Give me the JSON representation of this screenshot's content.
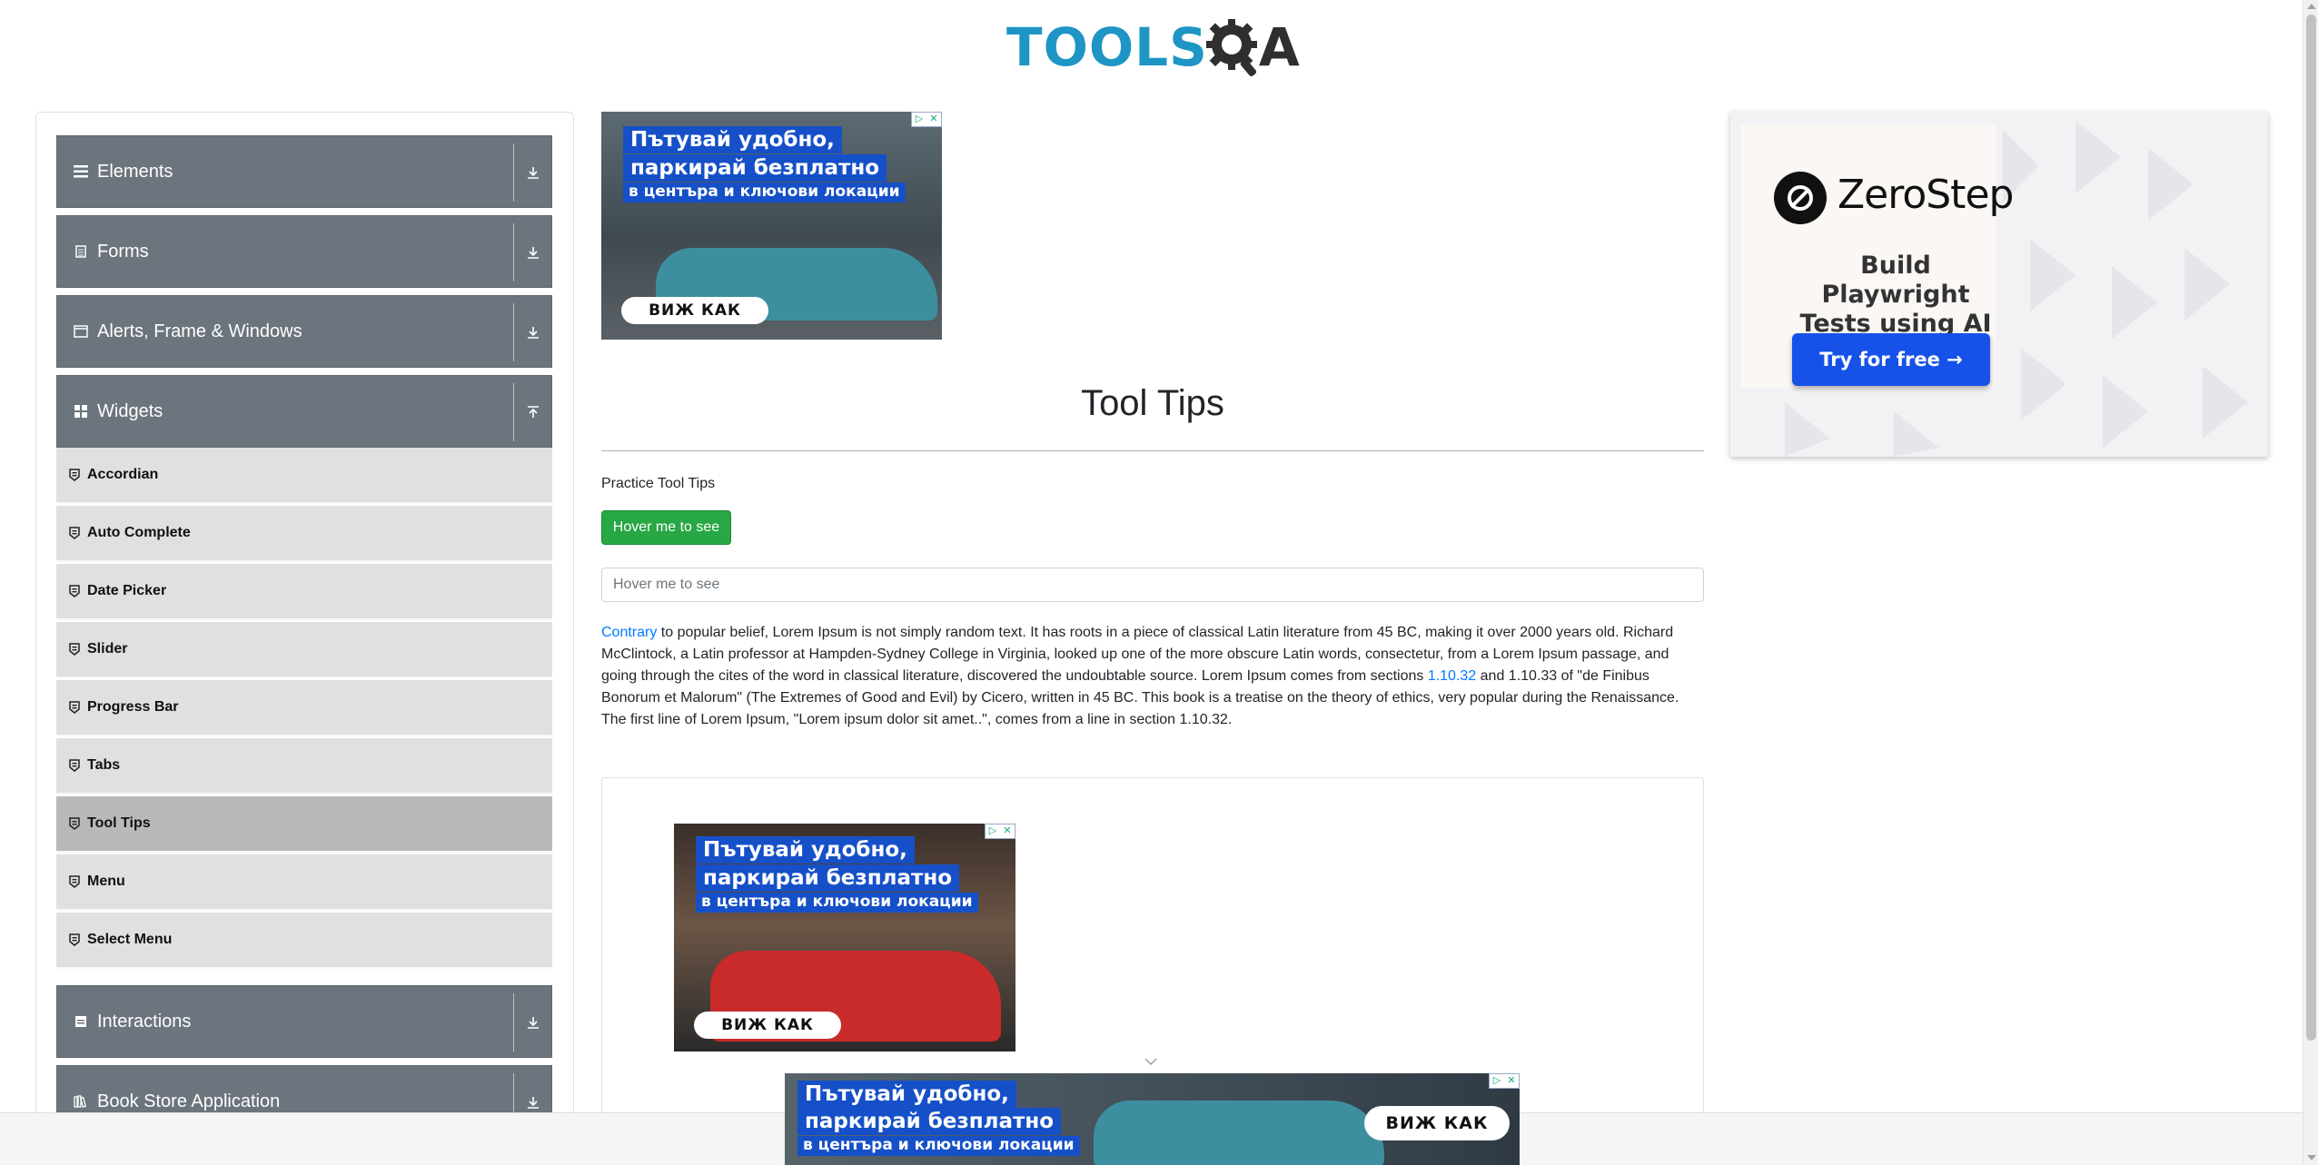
{
  "logo": {
    "text": "TOOLS",
    "suffix": "A"
  },
  "sidebar": {
    "groups": [
      {
        "label": "Elements",
        "icon": "hamburger-icon",
        "toggle": "download-arrow-icon"
      },
      {
        "label": "Forms",
        "icon": "document-icon",
        "toggle": "download-arrow-icon"
      },
      {
        "label": "Alerts, Frame & Windows",
        "icon": "window-icon",
        "toggle": "download-arrow-icon"
      },
      {
        "label": "Widgets",
        "icon": "grid-icon",
        "toggle": "upload-arrow-icon"
      },
      {
        "label": "Interactions",
        "icon": "interaction-icon",
        "toggle": "download-arrow-icon"
      },
      {
        "label": "Book Store Application",
        "icon": "books-icon",
        "toggle": "download-arrow-icon"
      }
    ],
    "widget_items": [
      {
        "label": "Accordian"
      },
      {
        "label": "Auto Complete"
      },
      {
        "label": "Date Picker"
      },
      {
        "label": "Slider"
      },
      {
        "label": "Progress Bar"
      },
      {
        "label": "Tabs"
      },
      {
        "label": "Tool Tips",
        "active": true
      },
      {
        "label": "Menu"
      },
      {
        "label": "Select Menu"
      }
    ]
  },
  "ads": {
    "bg_line1": "Пътувай удобно,",
    "bg_line2": "паркирай безплатно",
    "bg_line3": "в центъра и ключови локации",
    "bg_cta": "ВИЖ КАК",
    "zerostep_brand": "ZeroStep",
    "zerostep_sub": "Build Playwright Tests using AI",
    "zerostep_cta": "Try for free →"
  },
  "main": {
    "title": "Tool Tips",
    "practice_label": "Practice Tool Tips",
    "hover_button": "Hover me to see",
    "hover_input_placeholder": "Hover me to see",
    "paragraph": {
      "link1": "Contrary",
      "text1": " to popular belief, Lorem Ipsum is not simply random text. It has roots in a piece of classical Latin literature from 45 BC, making it over 2000 years old. Richard McClintock, a Latin professor at Hampden-Sydney College in Virginia, looked up one of the more obscure Latin words, consectetur, from a Lorem Ipsum passage, and going through the cites of the word in classical literature, discovered the undoubtable source. Lorem Ipsum comes from sections ",
      "link2": "1.10.32",
      "text2": " and 1.10.33 of \"de Finibus Bonorum et Malorum\" (The Extremes of Good and Evil) by Cicero, written in 45 BC. This book is a treatise on the theory of ethics, very popular during the Renaissance. The first line of Lorem Ipsum, \"Lorem ipsum dolor sit amet..\", comes from a line in section 1.10.32."
    }
  },
  "colors": {
    "accent": "#1e95c4",
    "sidebar_header": "#6c757d",
    "sidebar_item": "#e0e0e0",
    "sidebar_active": "#b9b9b9",
    "button_green": "#28a745",
    "link": "#007bff"
  }
}
